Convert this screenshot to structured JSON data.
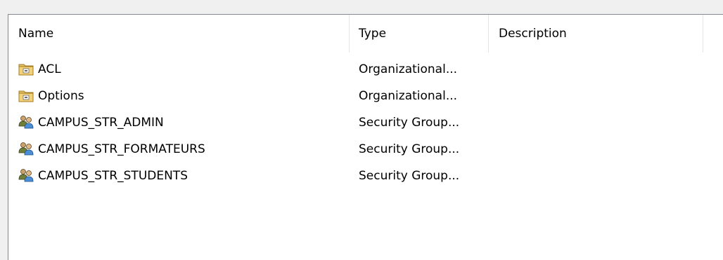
{
  "columns": {
    "name": "Name",
    "type": "Type",
    "description": "Description"
  },
  "rows": [
    {
      "name": "ACL",
      "type": "Organizational...",
      "icon": "ou-folder-icon"
    },
    {
      "name": "Options",
      "type": "Organizational...",
      "icon": "ou-folder-icon"
    },
    {
      "name": "CAMPUS_STR_ADMIN",
      "type": "Security Group...",
      "icon": "security-group-icon"
    },
    {
      "name": "CAMPUS_STR_FORMATEURS",
      "type": "Security Group...",
      "icon": "security-group-icon"
    },
    {
      "name": "CAMPUS_STR_STUDENTS",
      "type": "Security Group...",
      "icon": "security-group-icon"
    }
  ]
}
